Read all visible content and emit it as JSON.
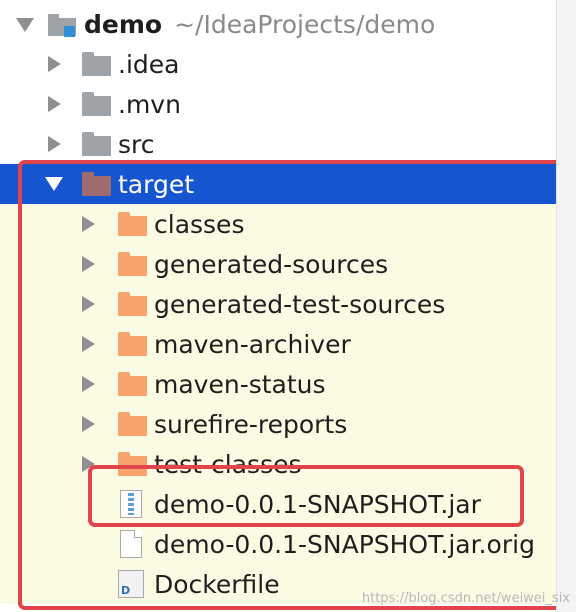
{
  "project": {
    "name": "demo",
    "path": "~/IdeaProjects/demo"
  },
  "tree": {
    "idea": ".idea",
    "mvn": ".mvn",
    "src": "src",
    "target": "target",
    "classes": "classes",
    "generated_sources": "generated-sources",
    "generated_test_sources": "generated-test-sources",
    "maven_archiver": "maven-archiver",
    "maven_status": "maven-status",
    "surefire_reports": "surefire-reports",
    "test_classes": "test-classes",
    "jar": "demo-0.0.1-SNAPSHOT.jar",
    "jar_original": "demo-0.0.1-SNAPSHOT.jar.orig",
    "dockerfile": "Dockerfile",
    "dockerfile_icon_letter": "D"
  },
  "watermark": "https://blog.csdn.net/weiwei_six",
  "colors": {
    "selection": "#1555d0",
    "highlight": "#e2444c",
    "excluded_bg": "#fbfbe4"
  },
  "icons": [
    "module-folder-icon",
    "folder-icon",
    "excluded-folder-icon",
    "jar-icon",
    "text-file-icon",
    "dockerfile-icon"
  ]
}
